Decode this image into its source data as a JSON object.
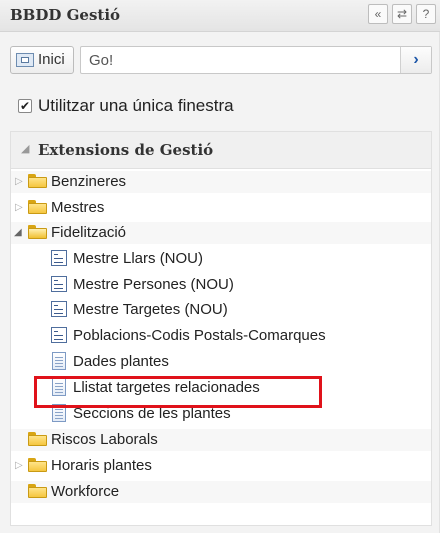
{
  "window": {
    "title": "BBDD Gestió",
    "buttons": [
      "«",
      "⇄",
      "?"
    ]
  },
  "toolbar": {
    "home_label": "Inici",
    "search_value": "Go!",
    "go_icon": "chevron-right-icon"
  },
  "options": {
    "single_window_label": "Utilitzar una única finestra",
    "single_window_checked": true
  },
  "tree": {
    "header": "Extensions de Gestió",
    "items": [
      {
        "label": "Benzineres",
        "type": "folder",
        "expanded": false,
        "has_children": true
      },
      {
        "label": "Mestres",
        "type": "folder",
        "expanded": false,
        "has_children": true
      },
      {
        "label": "Fidelització",
        "type": "folder",
        "expanded": true,
        "has_children": true
      },
      {
        "label": "Mestre Llars (NOU)",
        "type": "form"
      },
      {
        "label": "Mestre Persones (NOU)",
        "type": "form"
      },
      {
        "label": "Mestre Targetes (NOU)",
        "type": "form"
      },
      {
        "label": "Poblacions-Codis Postals-Comarques",
        "type": "form"
      },
      {
        "label": "Dades plantes",
        "type": "document"
      },
      {
        "label": "Llistat targetes relacionades",
        "type": "document",
        "highlighted": true
      },
      {
        "label": "Seccions de les plantes",
        "type": "document"
      },
      {
        "label": "Riscos Laborals",
        "type": "folder",
        "has_children": false
      },
      {
        "label": "Horaris plantes",
        "type": "folder",
        "expanded": false,
        "has_children": true
      },
      {
        "label": "Workforce",
        "type": "folder",
        "has_children": false
      }
    ]
  },
  "colors": {
    "highlight": "#e0121a",
    "folder": "#f5c640",
    "accent": "#1e57a8"
  }
}
